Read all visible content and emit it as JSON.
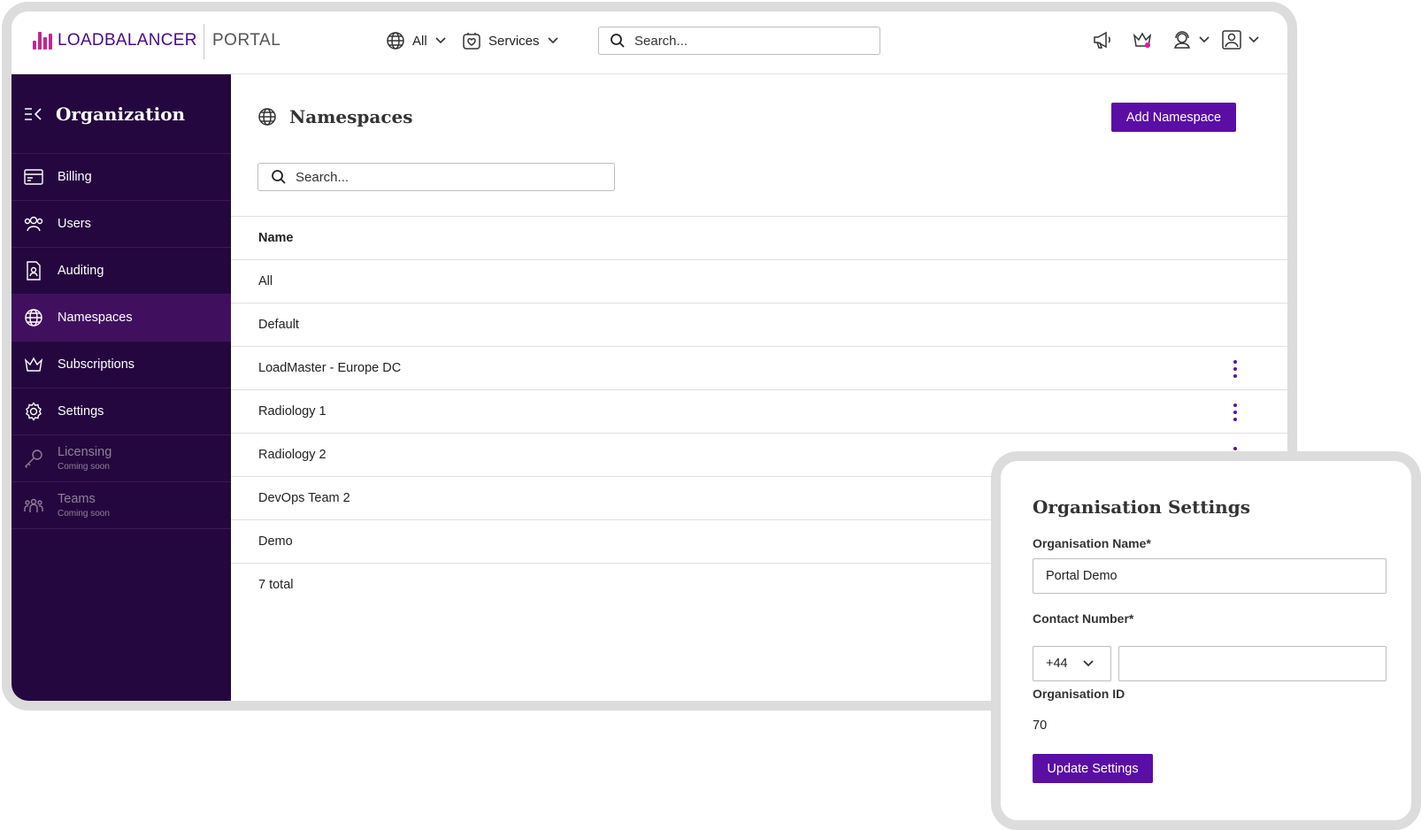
{
  "brand": {
    "logo_text": "LOADBALANCER",
    "product": "PORTAL",
    "accent": "#5a0ea6",
    "sidebar_bg": "#25073f",
    "logo_color": "#c0288f"
  },
  "topbar": {
    "namespace_dropdown": {
      "icon": "globe-icon",
      "label": "All"
    },
    "services_dropdown": {
      "icon": "services-icon",
      "label": "Services"
    },
    "search": {
      "placeholder": "Search..."
    },
    "icons": [
      "megaphone-icon",
      "crown-icon",
      "support-icon",
      "account-icon"
    ]
  },
  "sidebar": {
    "title": "Organization",
    "items": [
      {
        "label": "Billing",
        "icon": "billing-icon"
      },
      {
        "label": "Users",
        "icon": "users-icon"
      },
      {
        "label": "Auditing",
        "icon": "auditing-icon"
      },
      {
        "label": "Namespaces",
        "icon": "globe-icon",
        "active": true
      },
      {
        "label": "Subscriptions",
        "icon": "crown-icon"
      },
      {
        "label": "Settings",
        "icon": "gear-icon"
      },
      {
        "label": "Licensing",
        "sub": "Coming soon",
        "icon": "key-icon",
        "disabled": true
      },
      {
        "label": "Teams",
        "sub": "Coming soon",
        "icon": "teams-icon",
        "disabled": true
      }
    ]
  },
  "main": {
    "title": "Namespaces",
    "add_button": "Add Namespace",
    "search_placeholder": "Search...",
    "table": {
      "header": "Name",
      "rows": [
        "All",
        "Default",
        "LoadMaster - Europe DC",
        "Radiology 1",
        "Radiology 2",
        "DevOps Team 2",
        "Demo"
      ],
      "total": "7 total"
    }
  },
  "settings_card": {
    "title": "Organisation Settings",
    "org_name_label": "Organisation Name*",
    "org_name_value": "Portal Demo",
    "contact_label": "Contact Number*",
    "country_code": "+44",
    "contact_value": "",
    "org_id_label": "Organisation ID",
    "org_id_value": "70",
    "update_button": "Update Settings"
  }
}
